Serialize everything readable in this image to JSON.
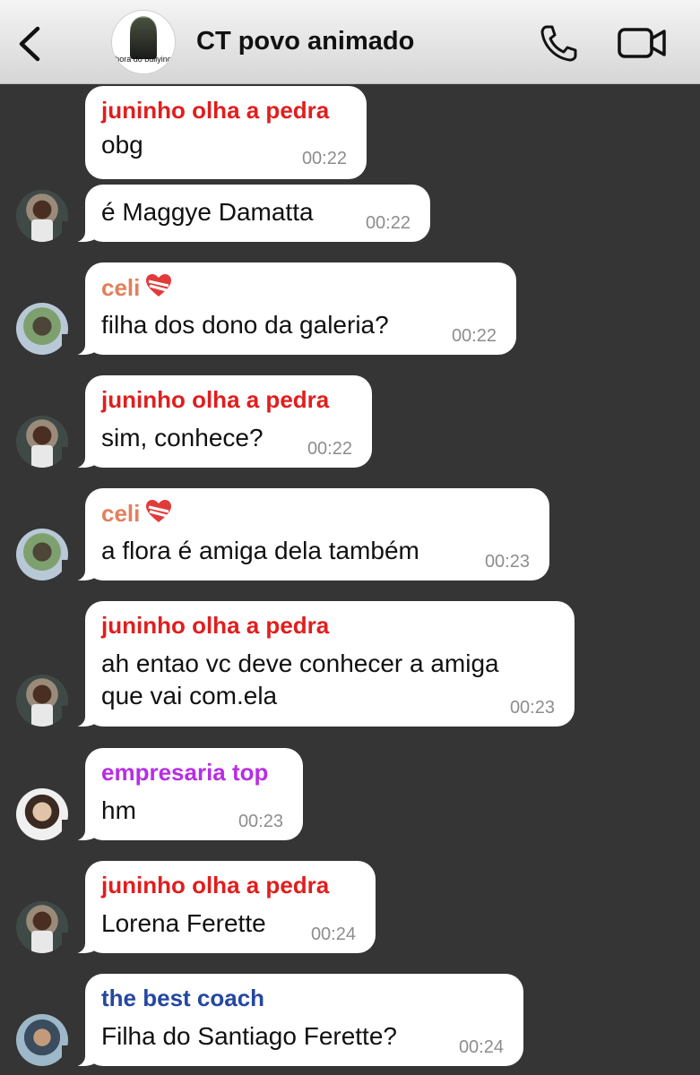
{
  "header": {
    "title": "CT povo animado",
    "avatar_caption": "hora do bullying"
  },
  "colors": {
    "juninho": "#e01e1e",
    "celi": "#e27f5c",
    "empresaria": "#b72ee3",
    "coach": "#2447a0",
    "background": "#353535"
  },
  "messages": [
    {
      "sender": "juninho olha a pedra",
      "text": "obg",
      "time": "00:22"
    },
    {
      "text": "é Maggye Damatta",
      "time": "00:22"
    },
    {
      "sender": "celi",
      "text": "filha dos dono da galeria?",
      "time": "00:22"
    },
    {
      "sender": "juninho olha a pedra",
      "text": "sim, conhece?",
      "time": "00:22"
    },
    {
      "sender": "celi",
      "text": "a flora é amiga dela também",
      "time": "00:23"
    },
    {
      "sender": "juninho olha a pedra",
      "text_line1": "ah entao vc deve conhecer a amiga",
      "text_line2": "que vai com.ela",
      "time": "00:23"
    },
    {
      "sender": "empresaria top",
      "text": "hm",
      "time": "00:23"
    },
    {
      "sender": "juninho olha a pedra",
      "text": "Lorena Ferette",
      "time": "00:24"
    },
    {
      "sender": "the best coach",
      "text": "Filha do Santiago Ferette?",
      "time": "00:24"
    }
  ]
}
